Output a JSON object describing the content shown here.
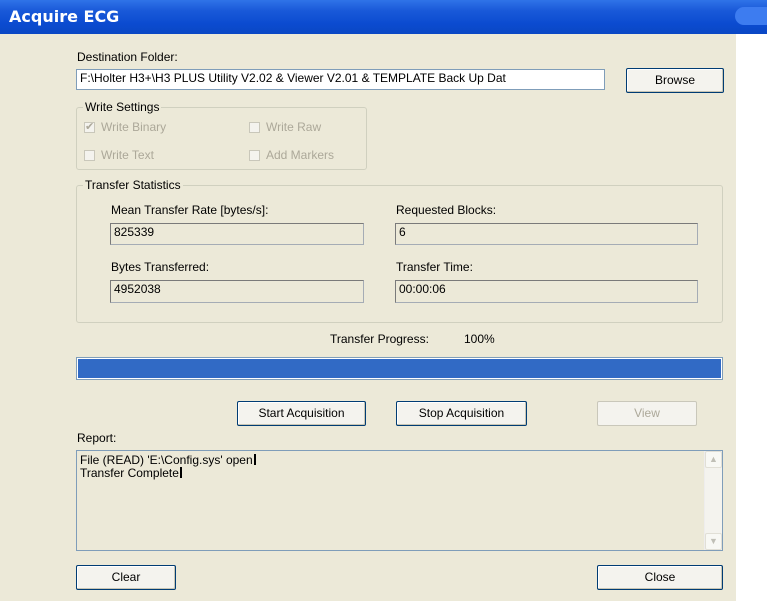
{
  "window": {
    "title": "Acquire ECG"
  },
  "destination": {
    "label": "Destination Folder:",
    "value": "F:\\Holter H3+\\H3 PLUS Utility V2.02 & Viewer V2.01 & TEMPLATE Back Up Dat",
    "browse_label": "Browse"
  },
  "write_settings": {
    "title": "Write Settings",
    "write_binary": {
      "label": "Write Binary",
      "checked": true,
      "enabled": false
    },
    "write_raw": {
      "label": "Write Raw",
      "checked": false,
      "enabled": false
    },
    "write_text": {
      "label": "Write Text",
      "checked": false,
      "enabled": false
    },
    "add_markers": {
      "label": "Add Markers",
      "checked": false,
      "enabled": false
    }
  },
  "transfer_statistics": {
    "title": "Transfer Statistics",
    "mean_rate_label": "Mean Transfer Rate [bytes/s]:",
    "mean_rate_value": "825339",
    "requested_blocks_label": "Requested Blocks:",
    "requested_blocks_value": "6",
    "bytes_transferred_label": "Bytes Transferred:",
    "bytes_transferred_value": "4952038",
    "transfer_time_label": "Transfer Time:",
    "transfer_time_value": "00:00:06"
  },
  "progress": {
    "label": "Transfer Progress:",
    "percent_text": "100%",
    "fraction": 1.0
  },
  "buttons": {
    "start": "Start Acquisition",
    "stop": "Stop Acquisition",
    "view": "View",
    "clear": "Clear",
    "close": "Close"
  },
  "report": {
    "label": "Report:",
    "lines": [
      "File (READ) 'E:\\Config.sys' open",
      "Transfer Complete"
    ]
  },
  "colors": {
    "title_bar": "#0b4bd0",
    "progress_fill": "#316ac5",
    "dialog_face": "#ece9d8"
  }
}
